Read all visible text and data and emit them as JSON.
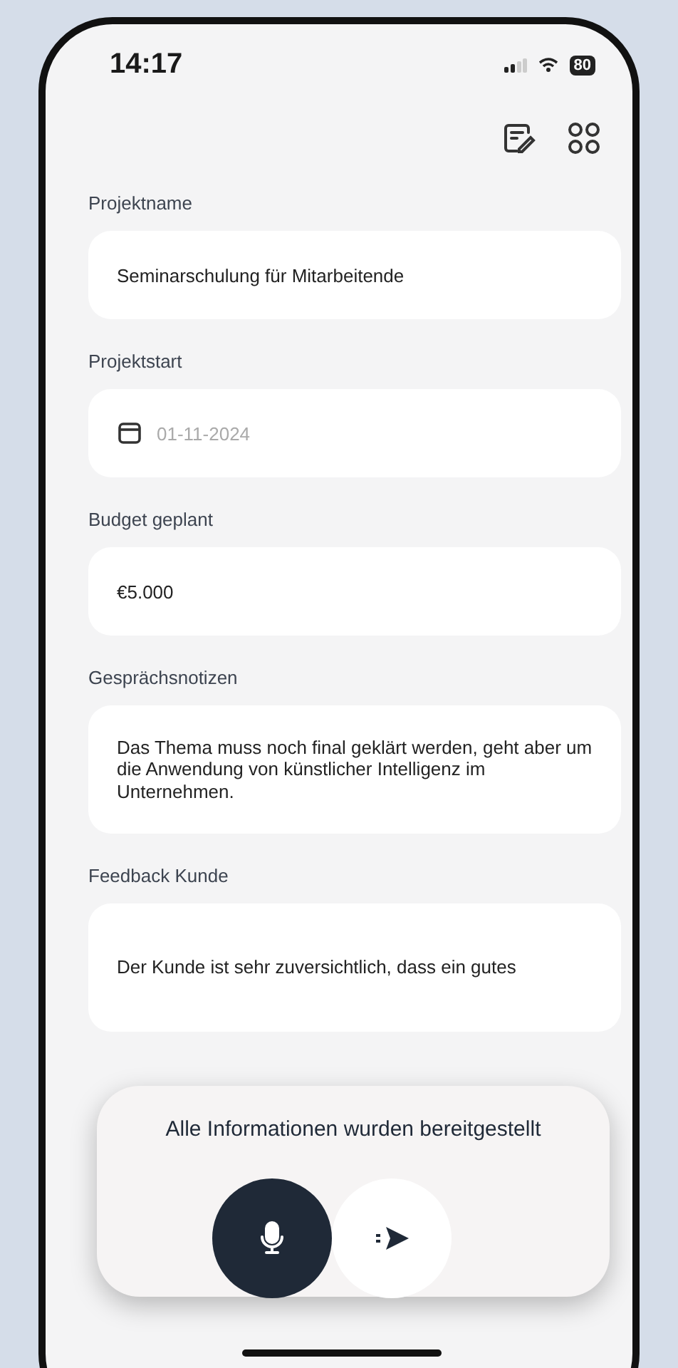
{
  "status_bar": {
    "time": "14:17",
    "battery": "80"
  },
  "fields": [
    {
      "label": "Projektname",
      "kind": "text",
      "value": "Seminarschulung für Mitarbeitende"
    },
    {
      "label": "Projektstart",
      "kind": "date",
      "placeholder": "01-11-2024"
    },
    {
      "label": "Budget geplant",
      "kind": "text",
      "value": "€5.000"
    },
    {
      "label": "Gesprächsnotizen",
      "kind": "multiline",
      "value": "Das Thema muss noch final geklärt werden, geht aber um die Anwendung von künstlicher Intelligenz im Unternehmen."
    },
    {
      "label": "Feedback Kunde",
      "kind": "multiline",
      "value": "Der Kunde ist sehr zuversichtlich, dass ein gutes"
    }
  ],
  "panel": {
    "message": "Alle Informationen wurden bereitgestellt",
    "buttons": [
      {
        "kind": "mic"
      },
      {
        "kind": "send"
      }
    ]
  }
}
